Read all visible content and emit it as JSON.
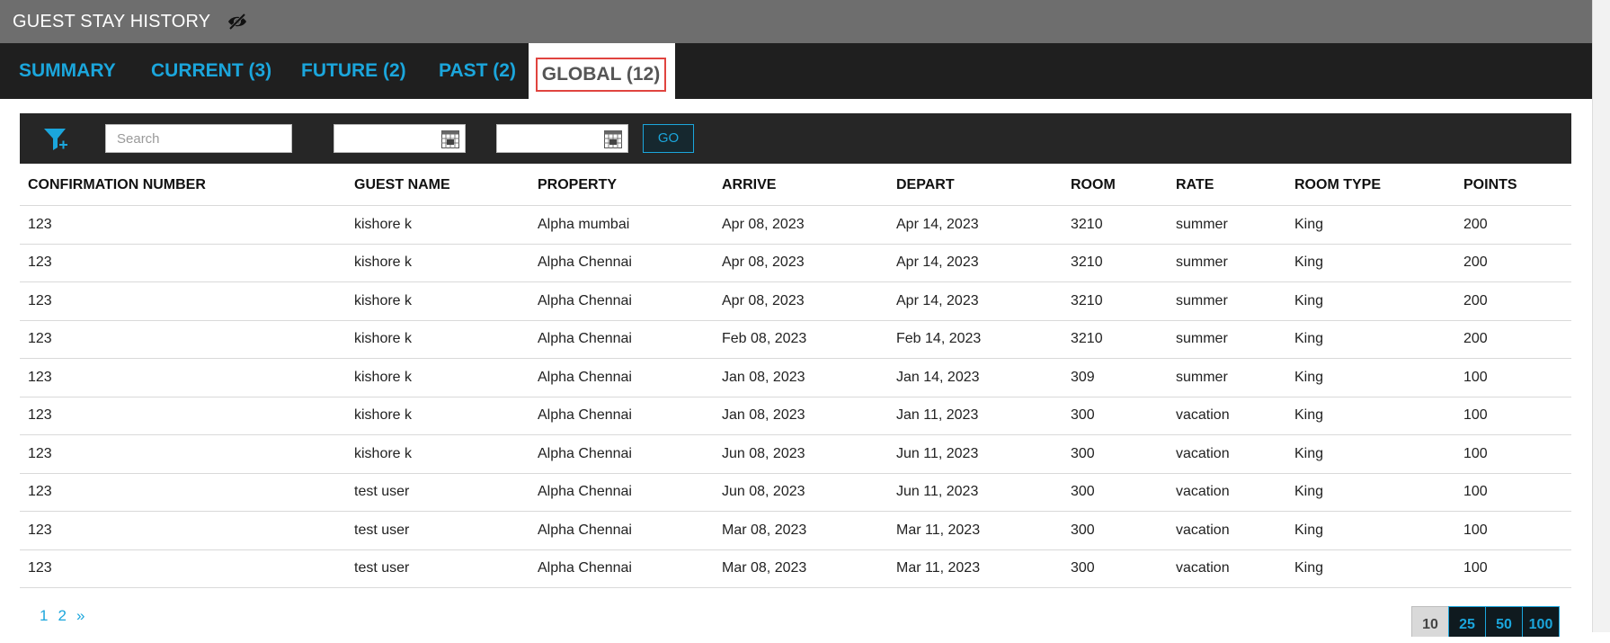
{
  "header": {
    "title": "GUEST STAY HISTORY",
    "icon": "eye-slash-icon"
  },
  "tabs": [
    {
      "label": "SUMMARY"
    },
    {
      "label": "CURRENT (3)"
    },
    {
      "label": "FUTURE (2)"
    },
    {
      "label": "PAST (2)"
    },
    {
      "label": "GLOBAL (12)",
      "active": true
    }
  ],
  "filters": {
    "filter_icon": "filter-add-icon",
    "search_placeholder": "Search",
    "date_from": "",
    "date_to": "",
    "go_label": "GO"
  },
  "table": {
    "columns": [
      "CONFIRMATION NUMBER",
      "GUEST NAME",
      "PROPERTY",
      "ARRIVE",
      "DEPART",
      "ROOM",
      "RATE",
      "ROOM TYPE",
      "POINTS"
    ],
    "rows": [
      [
        "123",
        "kishore k",
        "Alpha mumbai",
        "Apr 08, 2023",
        "Apr 14, 2023",
        "3210",
        "summer",
        "King",
        "200"
      ],
      [
        "123",
        "kishore k",
        "Alpha Chennai",
        "Apr 08, 2023",
        "Apr 14, 2023",
        "3210",
        "summer",
        "King",
        "200"
      ],
      [
        "123",
        "kishore k",
        "Alpha Chennai",
        "Apr 08, 2023",
        "Apr 14, 2023",
        "3210",
        "summer",
        "King",
        "200"
      ],
      [
        "123",
        "kishore k",
        "Alpha Chennai",
        "Feb 08, 2023",
        "Feb 14, 2023",
        "3210",
        "summer",
        "King",
        "200"
      ],
      [
        "123",
        "kishore k",
        "Alpha Chennai",
        "Jan 08, 2023",
        "Jan 14, 2023",
        "309",
        "summer",
        "King",
        "100"
      ],
      [
        "123",
        "kishore k",
        "Alpha Chennai",
        "Jan 08, 2023",
        "Jan 11, 2023",
        "300",
        "vacation",
        "King",
        "100"
      ],
      [
        "123",
        "kishore k",
        "Alpha Chennai",
        "Jun 08, 2023",
        "Jun 11, 2023",
        "300",
        "vacation",
        "King",
        "100"
      ],
      [
        "123",
        "test user",
        "Alpha Chennai",
        "Jun 08, 2023",
        "Jun 11, 2023",
        "300",
        "vacation",
        "King",
        "100"
      ],
      [
        "123",
        "test user",
        "Alpha Chennai",
        "Mar 08, 2023",
        "Mar 11, 2023",
        "300",
        "vacation",
        "King",
        "100"
      ],
      [
        "123",
        "test user",
        "Alpha Chennai",
        "Mar 08, 2023",
        "Mar 11, 2023",
        "300",
        "vacation",
        "King",
        "100"
      ]
    ]
  },
  "pagination": {
    "pages": [
      "1",
      "2"
    ],
    "next": "»"
  },
  "page_size": {
    "options": [
      "10",
      "25",
      "50",
      "100"
    ],
    "selected": "10"
  },
  "colors": {
    "accent": "#1ba6dc",
    "active_tab_outline": "#e0443f",
    "tabbar_bg": "#1f1f1f",
    "titlebar_bg": "#6e6e6e"
  }
}
